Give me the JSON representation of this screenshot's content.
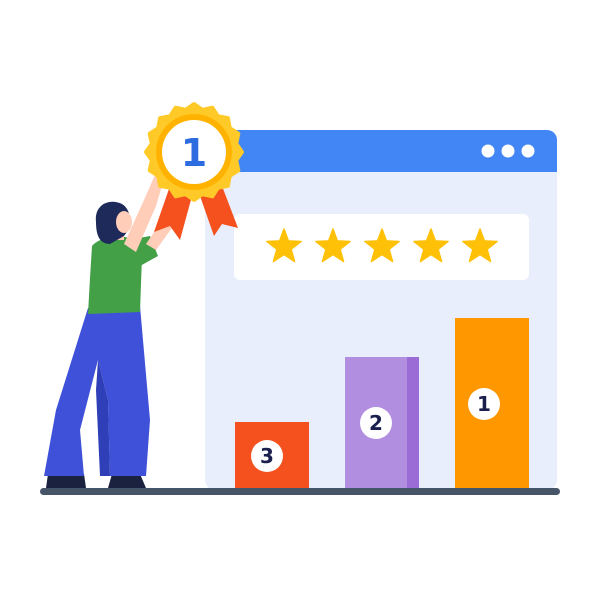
{
  "window": {
    "dots": [
      "dot",
      "dot",
      "dot"
    ]
  },
  "rating": {
    "stars": 5,
    "max": 5,
    "star_color": "#FFC107"
  },
  "podium": [
    {
      "rank": "3",
      "color": "#F4511E"
    },
    {
      "rank": "2",
      "color": "#B28EE0"
    },
    {
      "rank": "1",
      "color": "#FF9800"
    }
  ],
  "medal": {
    "rank": "1",
    "color": "#FFCA28",
    "ribbon_color": "#F4511E"
  },
  "colors": {
    "window_bar": "#4285F4",
    "window_body": "#E8EEFB",
    "floor": "#475569",
    "shirt": "#43A047",
    "pants": "#3F51D9",
    "hair": "#1E2A5A"
  }
}
